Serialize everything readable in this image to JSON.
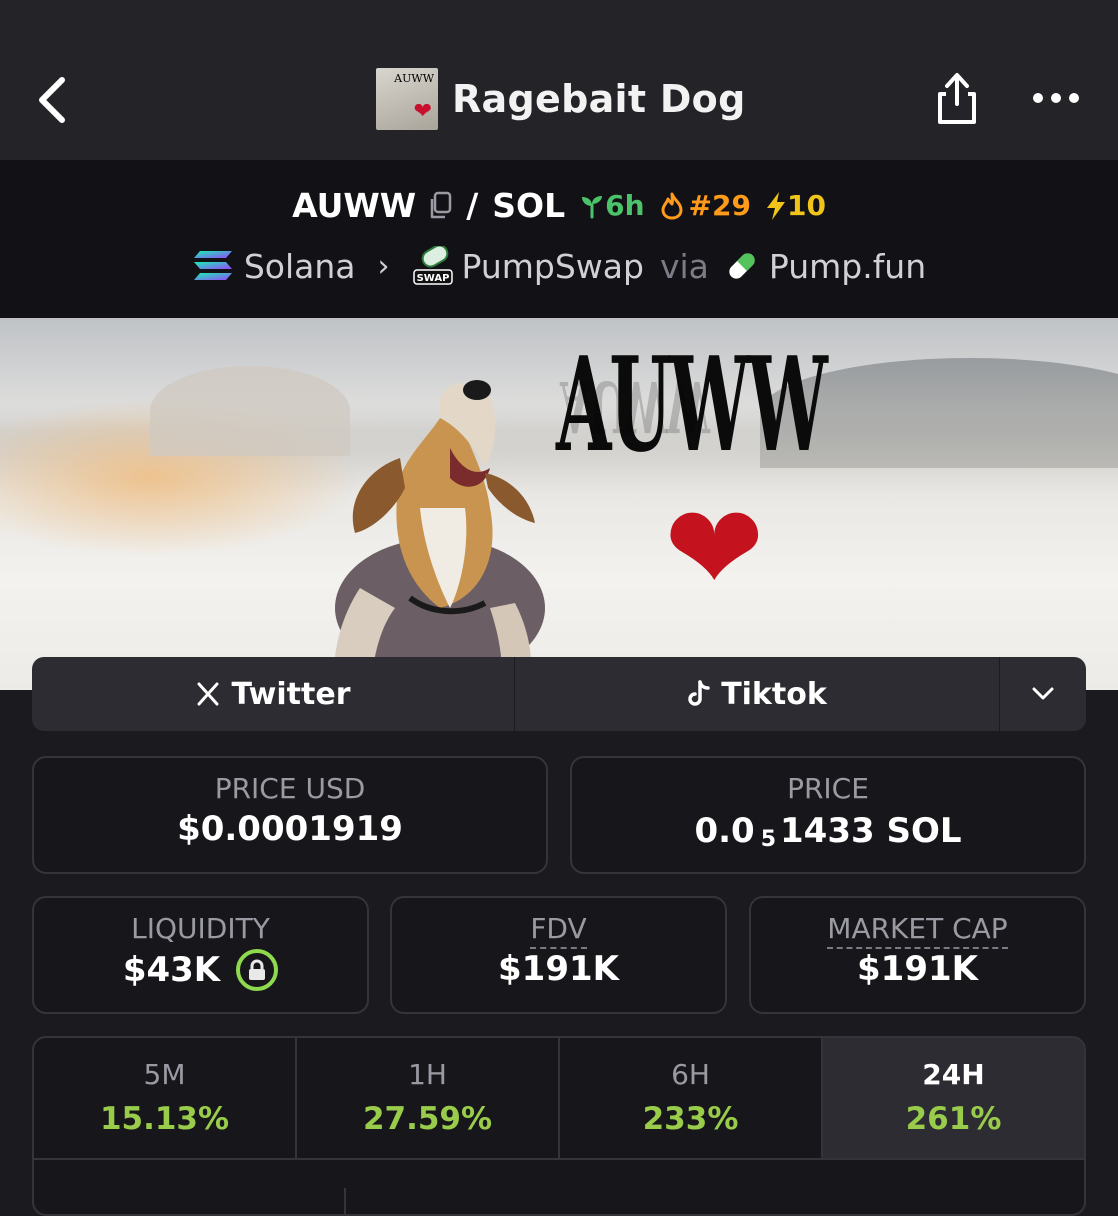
{
  "header": {
    "title": "Ragebait Dog",
    "thumb_label": "AUWW"
  },
  "pair": {
    "base": "AUWW",
    "separator": "/",
    "quote": "SOL",
    "age": "6h",
    "rank": "#29",
    "boosts": "10",
    "colors": {
      "age": "#4cc36a",
      "rank": "#ff9a1a",
      "boosts": "#f0c419"
    }
  },
  "chain": {
    "name": "Solana",
    "dex": "PumpSwap",
    "via_label": "via",
    "launchpad": "Pump.fun"
  },
  "banner": {
    "text": "AUWW"
  },
  "social": {
    "twitter_label": "Twitter",
    "tiktok_label": "Tiktok"
  },
  "stats": {
    "price_usd": {
      "label": "PRICE USD",
      "value": "$0.0001919"
    },
    "price": {
      "label": "PRICE",
      "prefix": "0.0",
      "subscript": "5",
      "suffix": "1433 SOL"
    },
    "liquidity": {
      "label": "LIQUIDITY",
      "value": "$43K"
    },
    "fdv": {
      "label": "FDV",
      "value": "$191K"
    },
    "market_cap": {
      "label": "MARKET CAP",
      "value": "$191K"
    }
  },
  "changes": [
    {
      "label": "5M",
      "value": "15.13%"
    },
    {
      "label": "1H",
      "value": "27.59%"
    },
    {
      "label": "6H",
      "value": "233%"
    },
    {
      "label": "24H",
      "value": "261%"
    }
  ],
  "colors": {
    "background": "#1a1a1f",
    "positive": "#99cc4a",
    "card_border": "#34343b"
  }
}
